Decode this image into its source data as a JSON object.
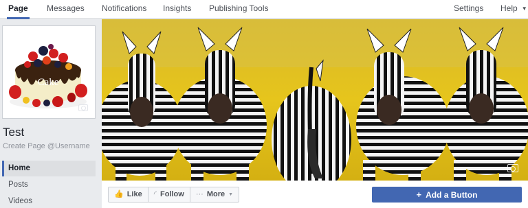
{
  "nav": {
    "tabs": [
      {
        "label": "Page",
        "active": true
      },
      {
        "label": "Messages"
      },
      {
        "label": "Notifications"
      },
      {
        "label": "Insights"
      },
      {
        "label": "Publishing Tools"
      }
    ],
    "settings_label": "Settings",
    "help_label": "Help",
    "help_icon": "caret-down-icon"
  },
  "profile": {
    "image_text": "Cake",
    "name": "Test",
    "username_prompt": "Create Page @Username",
    "camera_icon": "camera-icon"
  },
  "sidebar": {
    "items": [
      {
        "label": "Home",
        "active": true
      },
      {
        "label": "Posts"
      },
      {
        "label": "Videos"
      }
    ]
  },
  "cover": {
    "description": "",
    "camera_icon": "camera-icon"
  },
  "actions": {
    "like_label": "Like",
    "like_icon": "thumbs-up-icon",
    "follow_label": "Follow",
    "follow_icon": "rss-icon",
    "more_label": "More",
    "more_icon": "ellipsis-icon",
    "add_button_label": "Add a Button",
    "add_button_icon": "plus-icon"
  },
  "colors": {
    "accent": "#4267b2",
    "nav_bg": "#ffffff",
    "page_bg": "#e9ebee"
  }
}
